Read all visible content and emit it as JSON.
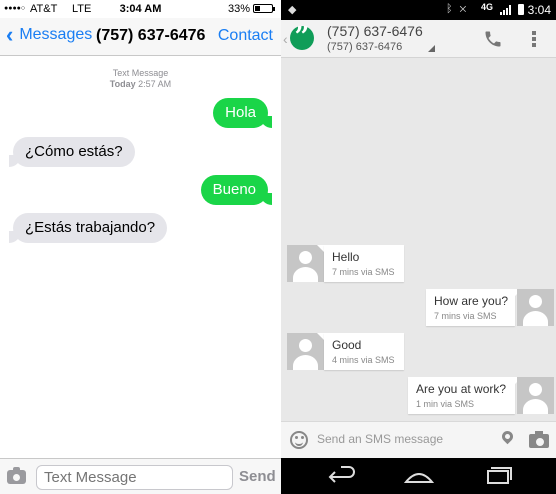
{
  "ios": {
    "status": {
      "carrier": "AT&T",
      "network": "LTE",
      "time": "3:04 AM",
      "battery_percent": "33%",
      "battery_level": 0.33
    },
    "nav": {
      "back_label": "Messages",
      "title": "(757) 637-6476",
      "contact_label": "Contact"
    },
    "timestamp": {
      "type": "Text Message",
      "day": "Today",
      "time": "2:57 AM"
    },
    "messages": [
      {
        "direction": "outgoing",
        "text": "Hola"
      },
      {
        "direction": "incoming",
        "text": "¿Cómo estás?"
      },
      {
        "direction": "outgoing",
        "text": "Bueno"
      },
      {
        "direction": "incoming",
        "text": "¿Estás trabajando?"
      }
    ],
    "input": {
      "placeholder": "Text Message",
      "send_label": "Send"
    }
  },
  "android": {
    "status": {
      "network": "4G",
      "time": "3:04"
    },
    "header": {
      "name": "(757) 637-6476",
      "number": "(757) 637-6476"
    },
    "messages": [
      {
        "direction": "incoming",
        "text": "Hello",
        "meta": "7 mins via SMS"
      },
      {
        "direction": "outgoing",
        "text": "How are you?",
        "meta": "7 mins via SMS"
      },
      {
        "direction": "incoming",
        "text": "Good",
        "meta": "4 mins via SMS"
      },
      {
        "direction": "outgoing",
        "text": "Are you at work?",
        "meta": "1 min via SMS"
      }
    ],
    "compose": {
      "placeholder": "Send an SMS message"
    }
  },
  "colors": {
    "ios_blue": "#1a7ef3",
    "ios_green_bubble": "#1ad548",
    "ios_gray_bubble": "#e5e5ea",
    "hangouts_green": "#0f9d58"
  }
}
